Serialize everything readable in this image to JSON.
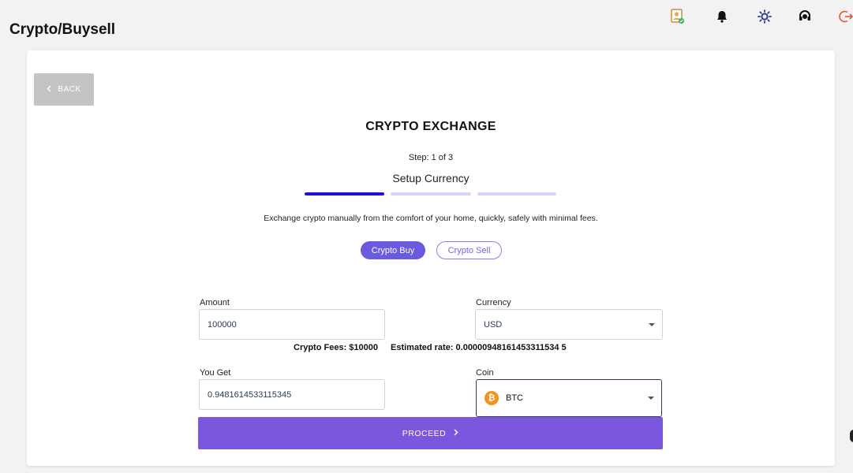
{
  "page": {
    "title": "Crypto/Buysell"
  },
  "topbar": {
    "icons": [
      "profile-icon",
      "bell-icon",
      "brightness-icon",
      "support-icon",
      "logout-icon"
    ],
    "accent": "#e05a3a"
  },
  "card": {
    "back_label": "BACK",
    "heading": "CRYPTO EXCHANGE",
    "step": "Step: 1 of 3",
    "step_name": "Setup Currency",
    "progress": {
      "current_step": 1,
      "total_steps": 3
    },
    "description": "Exchange crypto manually from the comfort of your home, quickly, safely with minimal fees.",
    "tabs": {
      "buy": "Crypto Buy",
      "sell": "Crypto Sell",
      "selected": "Crypto Buy"
    }
  },
  "form": {
    "amount": {
      "label": "Amount",
      "value": "100000"
    },
    "currency": {
      "label": "Currency",
      "value": "USD"
    },
    "fees_text": "Crypto Fees: $10000",
    "rate_text": "Estimated rate: 0.00000948161453311534 5",
    "you_get": {
      "label": "You Get",
      "value": "0.9481614533115345"
    },
    "coin": {
      "label": "Coin",
      "value": "BTC",
      "icon_glyph": "₿"
    },
    "proceed_label": "PROCEED"
  },
  "colors": {
    "primary": "#6a5ae0",
    "proceed": "#7b57de",
    "progress_active": "#1f14d6",
    "progress_inactive": "#d9d4f5",
    "bitcoin": "#f2931b"
  }
}
